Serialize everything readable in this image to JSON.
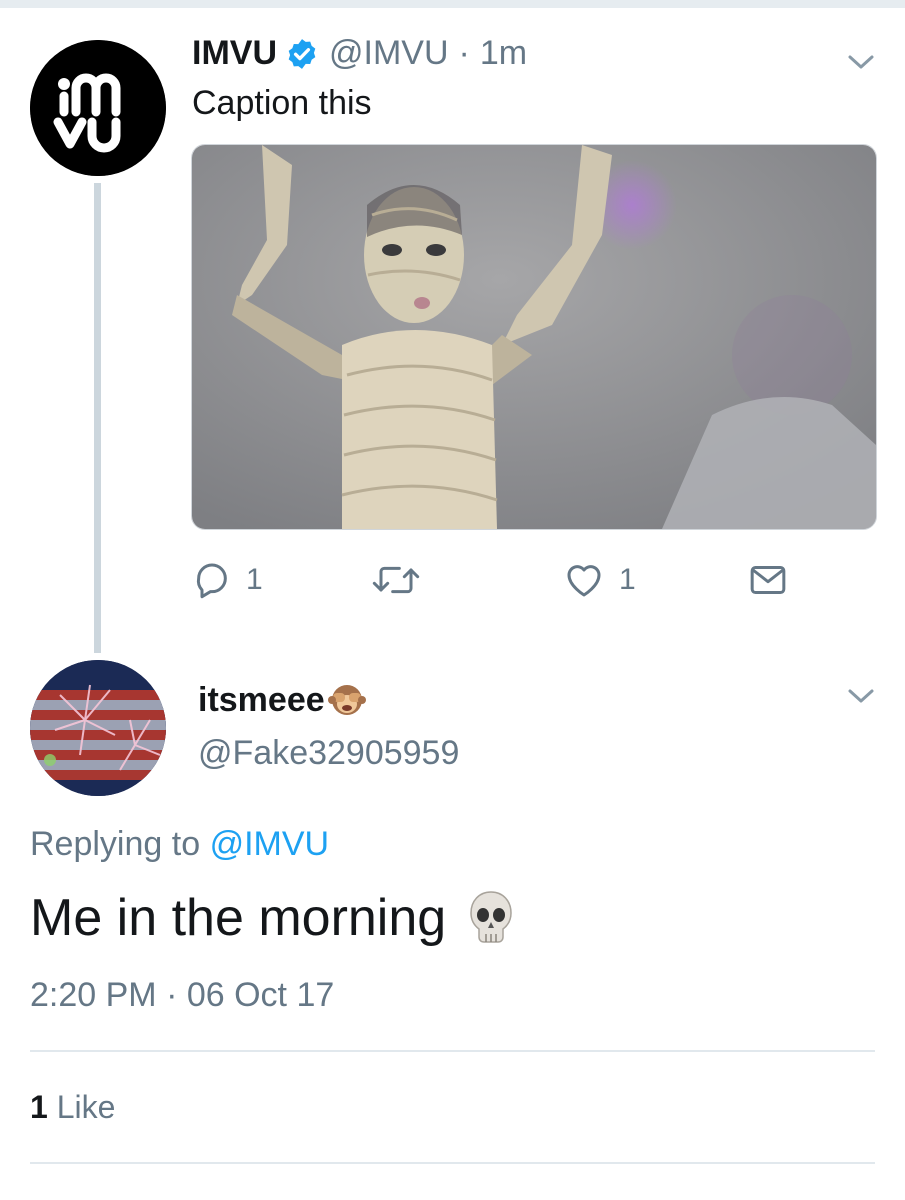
{
  "tweet": {
    "author_name": "IMVU",
    "handle": "@IMVU",
    "separator": "·",
    "time_ago": "1m",
    "text": "Caption this",
    "actions": {
      "reply_count": "1",
      "like_count": "1"
    }
  },
  "reply": {
    "author_name": "itsmeee",
    "handle": "@Fake32905959",
    "replying_prefix": "Replying to",
    "replying_to": "@IMVU",
    "text": "Me in the morning",
    "timestamp": "2:20 PM · 06 Oct 17",
    "likes_count": "1",
    "likes_label": "Like"
  },
  "colors": {
    "accent": "#1da1f2",
    "secondary_text": "#657786",
    "thread_line": "#ccd6dd"
  },
  "icons": {
    "verified": "verified-badge-icon",
    "caret": "chevron-down-icon",
    "reply": "reply-icon",
    "retweet": "retweet-icon",
    "like": "heart-icon",
    "dm": "envelope-icon",
    "name_emoji": "see-no-evil-monkey-icon",
    "text_emoji": "skull-icon"
  }
}
